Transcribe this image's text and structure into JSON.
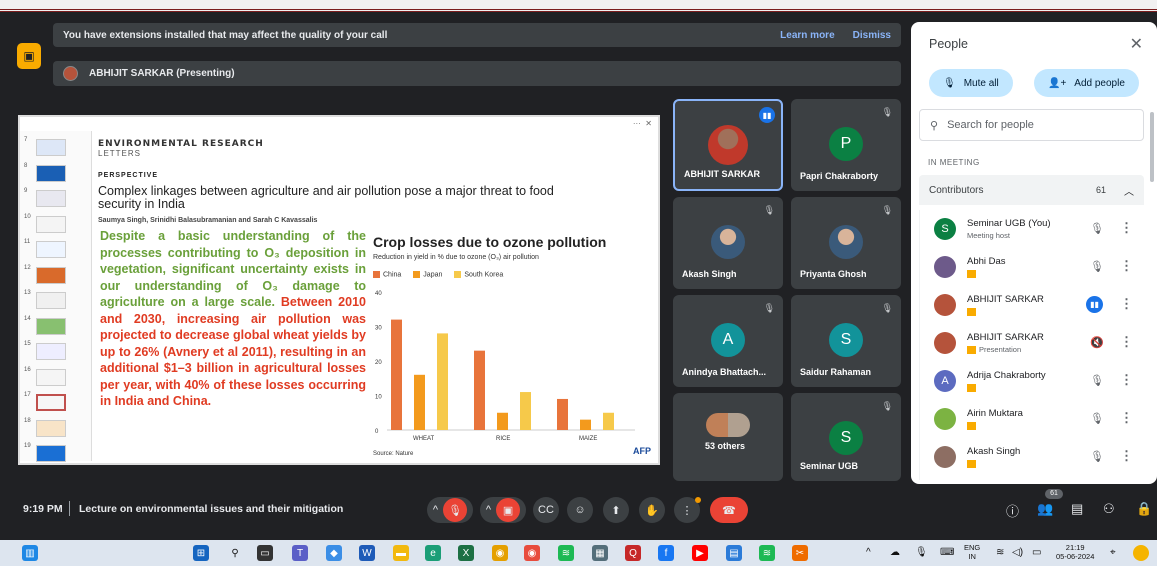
{
  "banner": {
    "message": "You have extensions installed that may affect the quality of your call",
    "learn_more": "Learn more",
    "dismiss": "Dismiss"
  },
  "presenter_bar": {
    "label": "ABHIJIT SARKAR (Presenting)"
  },
  "slide_panel": {
    "thumb_numbers": [
      "7",
      "8",
      "9",
      "10",
      "11",
      "12",
      "13",
      "14",
      "15",
      "16",
      "17",
      "18",
      "19"
    ],
    "journal_line1": "ENVIRONMENTAL RESEARCH",
    "journal_line2": "LETTERS",
    "section": "PERSPECTIVE",
    "title": "Complex linkages between agriculture and air pollution pose a major threat to food security in India",
    "authors": "Saumya Singh, Srinidhi Balasubramanian and Sarah C Kavassalis",
    "body_green": "Despite a basic understanding of the processes contributing to O₃ deposition in vegetation, significant uncertainty exists in our understanding of O₃ damage to agriculture on a large scale.",
    "body_red_1": "Between 2010 and 2030, increasing air pollution was projected to decrease global wheat yields by up to 26%",
    "body_green_2": "(Avnery et al 2011), resulting in an additional $1–3 billion in agricultural losses per year, with 40% of these losses occurring in India and China."
  },
  "chart_data": {
    "type": "bar",
    "title": "Crop losses due to ozone pollution",
    "subtitle": "Reduction in yield in % due to ozone (O₃) air pollution",
    "categories": [
      "WHEAT",
      "RICE",
      "MAIZE"
    ],
    "series": [
      {
        "name": "China",
        "values": [
          32,
          23,
          9
        ],
        "color": "#e8743b"
      },
      {
        "name": "Japan",
        "values": [
          16,
          5,
          3
        ],
        "color": "#f39a1d"
      },
      {
        "name": "South Korea",
        "values": [
          28,
          11,
          5
        ],
        "color": "#f6c94a"
      }
    ],
    "ylim": [
      0,
      40
    ],
    "yticks": [
      "0",
      "10",
      "20",
      "30",
      "40"
    ],
    "source": "Source: Nature",
    "credit": "AFP",
    "grid": false,
    "legend": "top-left"
  },
  "tiles": [
    {
      "name": "ABHIJIT SARKAR",
      "kind": "photo"
    },
    {
      "name": "Papri Chakraborty",
      "initial": "P",
      "color": "#0b8043"
    },
    {
      "name": "Akash Singh",
      "kind": "photo"
    },
    {
      "name": "Priyanta Ghosh",
      "kind": "photo"
    },
    {
      "name": "Anindya Bhattach...",
      "initial": "A",
      "color": "#12939a"
    },
    {
      "name": "Saidur Rahaman",
      "initial": "S",
      "color": "#12939a"
    },
    {
      "name": "53 others",
      "kind": "group"
    },
    {
      "name": "Seminar UGB",
      "initial": "S",
      "color": "#0b8043"
    }
  ],
  "people": {
    "title": "People",
    "mute_all": "Mute all",
    "add_people": "Add people",
    "search_placeholder": "Search for people",
    "in_meeting": "IN MEETING",
    "contributors": "Contributors",
    "count": "61",
    "list": [
      {
        "name": "Seminar UGB (You)",
        "sub": "Meeting host",
        "initial": "S",
        "color": "#0b8043"
      },
      {
        "name": "Abhi Das",
        "sub": "",
        "initial": "",
        "color": "#6d5a8a"
      },
      {
        "name": "ABHIJIT SARKAR",
        "sub": "",
        "initial": "",
        "color": "#b5533b"
      },
      {
        "name": "ABHIJIT SARKAR",
        "sub": "Presentation",
        "initial": "",
        "color": "#b5533b"
      },
      {
        "name": "Adrija Chakraborty",
        "sub": "",
        "initial": "A",
        "color": "#5c6bc0"
      },
      {
        "name": "Airin Muktara",
        "sub": "",
        "initial": "",
        "color": "#7cb342"
      },
      {
        "name": "Akash Singh",
        "sub": "",
        "initial": "",
        "color": "#8d6e63"
      }
    ]
  },
  "bottom": {
    "time": "9:19 PM",
    "meeting_title": "Lecture on environmental issues and their mitigation",
    "participants_badge": "61"
  },
  "taskbar": {
    "lang": "ENG",
    "region": "IN",
    "clock_time": "21:19",
    "clock_date": "05-06-2024"
  }
}
